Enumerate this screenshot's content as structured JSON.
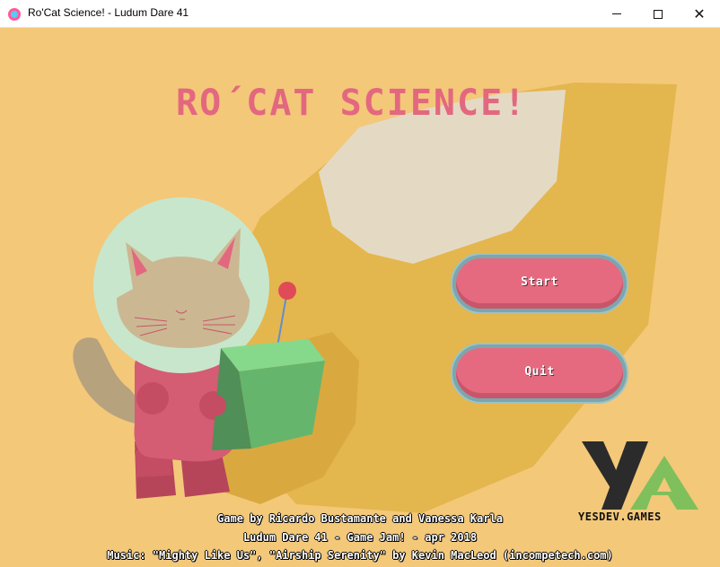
{
  "window": {
    "title": "Ro'Cat Science! - Ludum Dare 41",
    "icon": "heart-app-icon",
    "controls": [
      "minimize-icon",
      "maximize-icon",
      "close-icon"
    ]
  },
  "game": {
    "title": "RO´CAT SCIENCE!",
    "menu": {
      "start_label": "Start",
      "quit_label": "Quit"
    },
    "logo_text": "YESDEV.GAMES",
    "credits": [
      "Game by Ricardo Bustamante and Vanessa Karla",
      "Ludum Dare 41 - Game Jam! - apr 2018",
      "Music: \"Mighty Like Us\", \"Airship Serenity\" by Kevin MacLeod (incompetech.com)"
    ]
  },
  "colors": {
    "background": "#f3c879",
    "title": "#e3687f",
    "button_face": "#e56a80",
    "button_border": "#7da6ac"
  }
}
